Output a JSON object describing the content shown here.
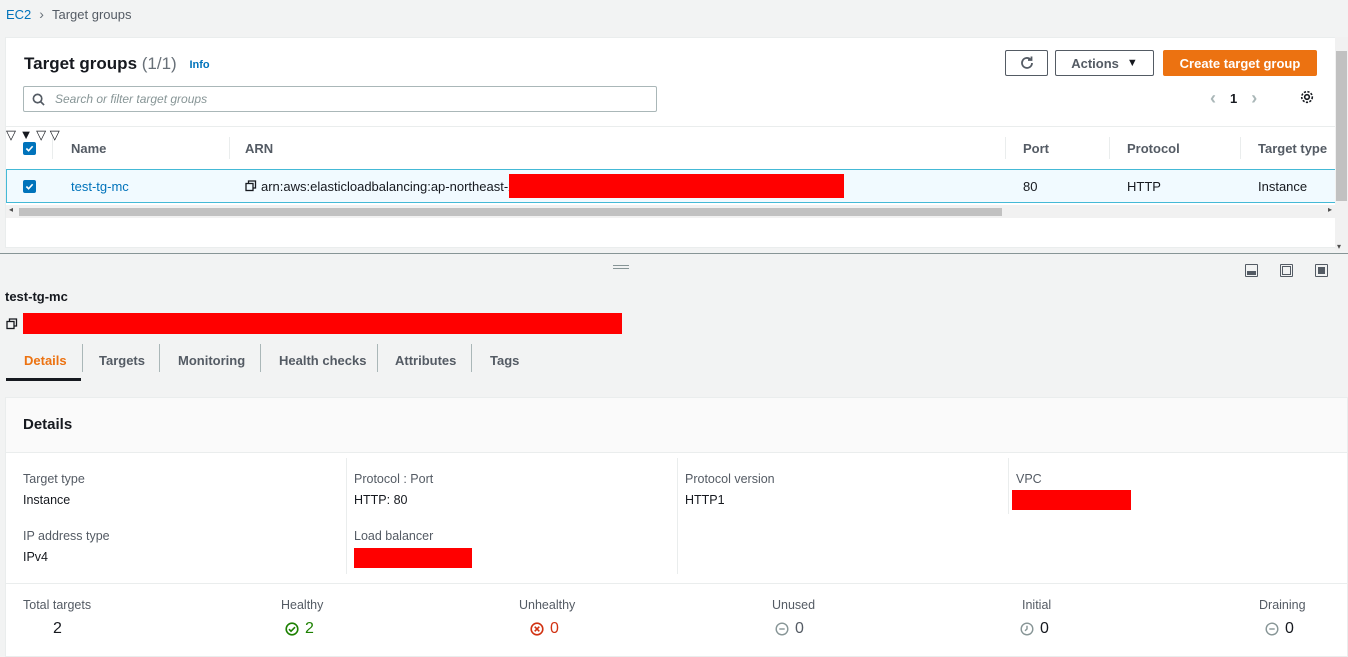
{
  "breadcrumb": {
    "root": "EC2",
    "current": "Target groups"
  },
  "header": {
    "title": "Target groups",
    "count": "(1/1)",
    "info": "Info",
    "actions_label": "Actions",
    "create_label": "Create target group",
    "search_placeholder": "Search or filter target groups",
    "page": "1"
  },
  "table": {
    "columns": [
      "Name",
      "ARN",
      "Port",
      "Protocol",
      "Target type"
    ],
    "rows": [
      {
        "name": "test-tg-mc",
        "arn": "arn:aws:elasticloadbalancing:ap-northeast-2:",
        "port": "80",
        "protocol": "HTTP",
        "target_type": "Instance"
      }
    ]
  },
  "detail": {
    "name": "test-tg-mc",
    "tabs": [
      "Details",
      "Targets",
      "Monitoring",
      "Health checks",
      "Attributes",
      "Tags"
    ],
    "section_title": "Details",
    "fields": {
      "target_type_label": "Target type",
      "target_type": "Instance",
      "protocol_port_label": "Protocol : Port",
      "protocol_port": "HTTP: 80",
      "protocol_version_label": "Protocol version",
      "protocol_version": "HTTP1",
      "vpc_label": "VPC",
      "ip_type_label": "IP address type",
      "ip_type": "IPv4",
      "lb_label": "Load balancer"
    },
    "stats": {
      "total_label": "Total targets",
      "total": "2",
      "healthy_label": "Healthy",
      "healthy": "2",
      "unhealthy_label": "Unhealthy",
      "unhealthy": "0",
      "unused_label": "Unused",
      "unused": "0",
      "initial_label": "Initial",
      "initial": "0",
      "draining_label": "Draining",
      "draining": "0"
    }
  },
  "colors": {
    "accent": "#ec7211",
    "link": "#0073bb",
    "healthy": "#1d8102",
    "unhealthy": "#d13212",
    "redacted": "#ff0000"
  }
}
